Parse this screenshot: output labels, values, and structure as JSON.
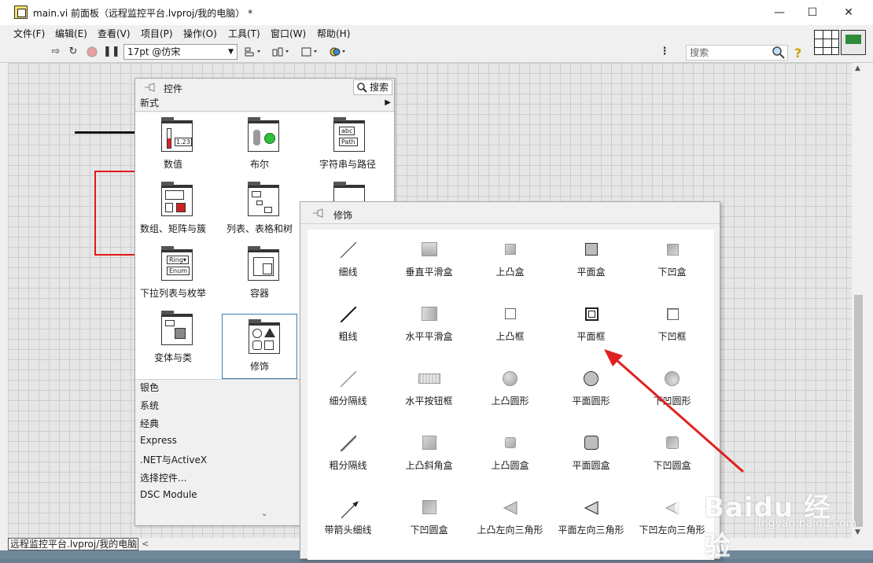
{
  "window": {
    "title": "main.vi 前面板（远程监控平台.lvproj/我的电脑） *",
    "buttons": {
      "minimize": "—",
      "maximize": "☐",
      "close": "✕"
    }
  },
  "menu": [
    "文件(F)",
    "编辑(E)",
    "查看(V)",
    "项目(P)",
    "操作(O)",
    "工具(T)",
    "窗口(W)",
    "帮助(H)"
  ],
  "toolbar": {
    "font": "17pt @仿宋",
    "search_placeholder": "搜索",
    "help": "?"
  },
  "controls_palette": {
    "title": "控件",
    "search_label": "搜索",
    "section": "新式",
    "categories": [
      "数值",
      "布尔",
      "字符串与路径",
      "数组、矩阵与簇",
      "列表、表格和树",
      "",
      "下拉列表与枚举",
      "容器",
      "",
      "变体与类",
      "修饰"
    ],
    "selected": "修饰",
    "list": [
      "银色",
      "系统",
      "经典",
      "Express",
      ".NET与ActiveX",
      "选择控件...",
      "DSC Module"
    ],
    "more": "⌄"
  },
  "decorations_palette": {
    "title": "修饰",
    "items": [
      "细线",
      "垂直平滑盒",
      "上凸盒",
      "平面盒",
      "下凹盒",
      "粗线",
      "水平平滑盒",
      "上凸框",
      "平面框",
      "下凹框",
      "细分隔线",
      "水平按钮框",
      "上凸圆形",
      "平面圆形",
      "下凹圆形",
      "粗分隔线",
      "上凸斜角盒",
      "上凸圆盒",
      "平面圆盒",
      "下凹圆盒",
      "带箭头细线",
      "下凹圆盒",
      "上凸左向三角形",
      "平面左向三角形",
      "下凹左向三角形"
    ]
  },
  "status": {
    "context": "远程监控平台.lvproj/我的电脑"
  },
  "watermark": {
    "main": "Baidu 经验",
    "sub": "jingyan.baidu.com"
  },
  "colors": {
    "annotation_arrow": "#e02020",
    "selection": "#3c7fb1",
    "red_box": "#e01818"
  }
}
